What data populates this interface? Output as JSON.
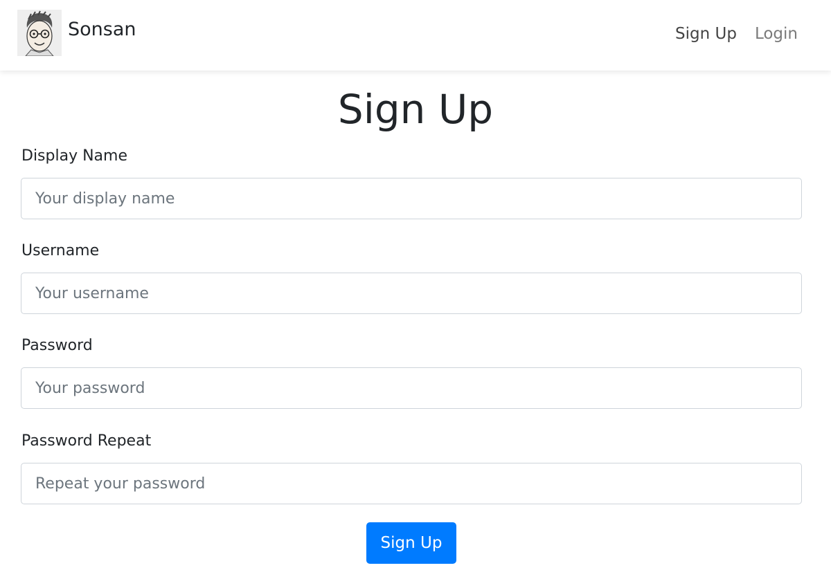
{
  "navbar": {
    "brand_name": "Sonsan",
    "links": [
      {
        "label": "Sign Up"
      },
      {
        "label": "Login"
      }
    ]
  },
  "page": {
    "title": "Sign Up"
  },
  "form": {
    "fields": [
      {
        "label": "Display Name",
        "placeholder": "Your display name",
        "value": ""
      },
      {
        "label": "Username",
        "placeholder": "Your username",
        "value": ""
      },
      {
        "label": "Password",
        "placeholder": "Your password",
        "value": ""
      },
      {
        "label": "Password Repeat",
        "placeholder": "Repeat your password",
        "value": ""
      }
    ],
    "submit_label": "Sign Up"
  },
  "colors": {
    "primary": "#007bff",
    "text": "#212529",
    "placeholder": "#6c757d",
    "border": "#ced4da"
  }
}
